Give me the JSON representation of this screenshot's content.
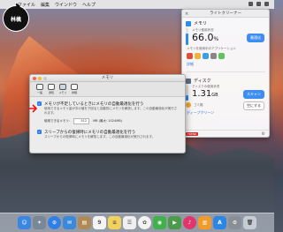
{
  "menubar": {
    "menus": [
      "ファイル",
      "編集",
      "ウインドウ",
      "ヘルプ"
    ]
  },
  "logo": {
    "text": "林檎"
  },
  "panel": {
    "title": "ライトクリーナー",
    "memory": {
      "label": "メモリ",
      "available_label": "メモリ使用状況",
      "value": "66.0",
      "unit": "%",
      "fill_percent": 66,
      "apps_label": "メモリを使用中のアプリケーション",
      "clean_button": "最適化",
      "app_icon_colors": [
        "#e44d3a",
        "#f0b33a",
        "#3aa0e4",
        "#888888",
        "#5fc45a"
      ],
      "link": "詳細"
    },
    "disk": {
      "label": "ディスク",
      "usage_label": "ディスクの使用状況",
      "value": "1.31",
      "unit": "GB",
      "fill_percent": 30,
      "clean_button": "スキャン",
      "trash_label": "ゴミ箱",
      "trash_button": "空にする",
      "link": "ディープクリーン"
    },
    "footer": {
      "brand": "TREND",
      "text": ""
    }
  },
  "prefs": {
    "title": "メモリ",
    "tabs": [
      {
        "label": "一般",
        "active": false
      },
      {
        "label": "通知",
        "active": false
      },
      {
        "label": "メモリ",
        "active": true
      },
      {
        "label": "詳細",
        "active": false
      }
    ],
    "option1": {
      "title": "メモリが不足しているときにメモリの自動最適化を行う",
      "desc": "使用できるメモリ量が次の値を下回ると自動的にメモリを解放します。この自動最適化が実行されます。",
      "size_label": "使用できるメモリ:",
      "size_value": "512",
      "size_unit": "MB (最大: 1024MB)"
    },
    "option2": {
      "title": "スリープからの復帰時にメモリの自動最適化を行う",
      "desc": "スリープからの復帰時にメモリを解放します。この自動最適化が実行されます。"
    }
  },
  "dock": {
    "items": [
      {
        "name": "finder",
        "color": "#3a86e0",
        "glyph": "☺"
      },
      {
        "name": "launchpad",
        "color": "#7a8794",
        "glyph": "✦"
      },
      {
        "name": "safari",
        "color": "#2f7fe6",
        "glyph": "⊙"
      },
      {
        "name": "mail",
        "color": "#3b8ad9",
        "glyph": "✉"
      },
      {
        "name": "contacts",
        "color": "#b08a56",
        "glyph": "▤"
      },
      {
        "name": "calendar",
        "color": "#f4f4f4",
        "glyph": "9"
      },
      {
        "name": "notes",
        "color": "#f1d25b",
        "glyph": "≡"
      },
      {
        "name": "reminders",
        "color": "#efefef",
        "glyph": "☰"
      },
      {
        "name": "photos",
        "color": "#f3f3f3",
        "glyph": "✿"
      },
      {
        "name": "messages",
        "color": "#3fb24a",
        "glyph": "◉"
      },
      {
        "name": "facetime",
        "color": "#4a9b4a",
        "glyph": "▶"
      },
      {
        "name": "itunes",
        "color": "#e2356e",
        "glyph": "♪"
      },
      {
        "name": "ibooks",
        "color": "#f39a2a",
        "glyph": "▥"
      },
      {
        "name": "appstore",
        "color": "#2b86e4",
        "glyph": "A"
      },
      {
        "name": "preferences",
        "color": "#8a8f96",
        "glyph": "⚙"
      },
      {
        "name": "trash",
        "color": "#c6ccd3",
        "glyph": "🗑"
      }
    ]
  }
}
